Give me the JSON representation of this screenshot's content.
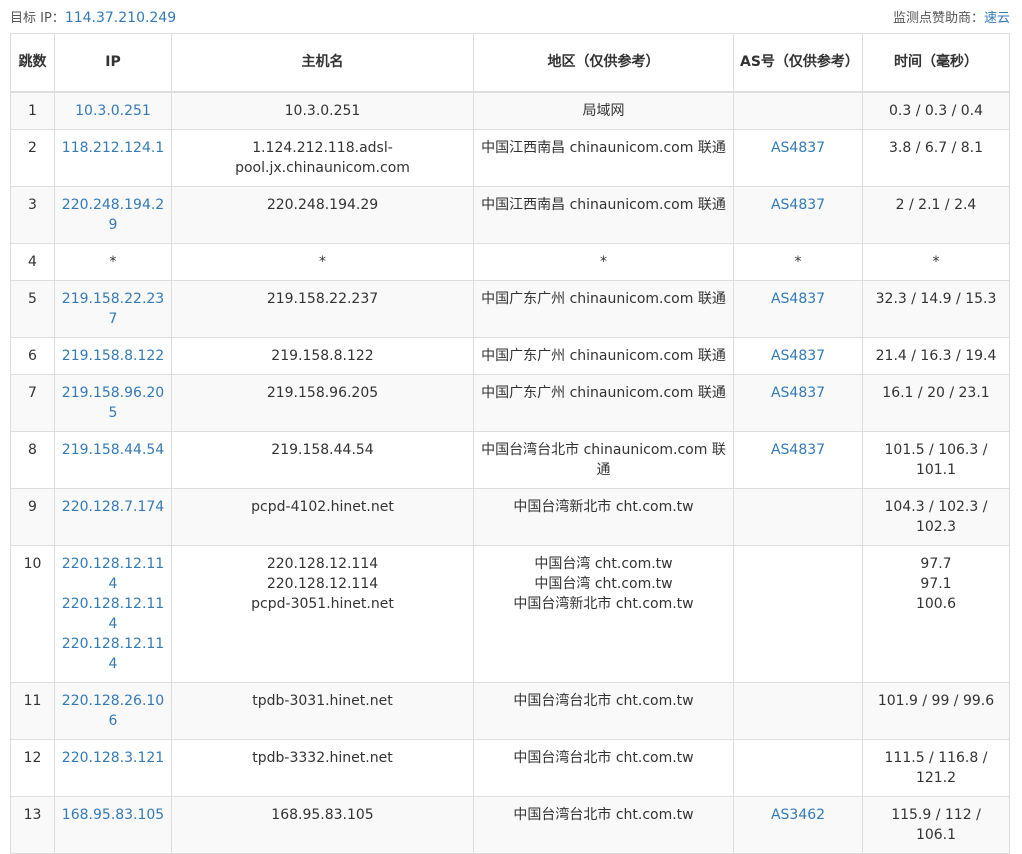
{
  "header": {
    "target_label": "目标 IP：",
    "target_ip": "114.37.210.249",
    "sponsor_label": "监测点赞助商：",
    "sponsor_name": "速云"
  },
  "columns": [
    "跳数",
    "IP",
    "主机名",
    "地区（仅供参考）",
    "AS号（仅供参考）",
    "时间（毫秒）"
  ],
  "rows": [
    {
      "hop": "1",
      "ips": [
        "10.3.0.251"
      ],
      "hosts": [
        "10.3.0.251"
      ],
      "regions": [
        "局域网"
      ],
      "asn": "",
      "times": [
        "0.3 / 0.3 / 0.4"
      ]
    },
    {
      "hop": "2",
      "ips": [
        "118.212.124.1"
      ],
      "hosts": [
        "1.124.212.118.adsl-pool.jx.chinaunicom.com"
      ],
      "regions": [
        "中国江西南昌 chinaunicom.com 联通"
      ],
      "asn": "AS4837",
      "times": [
        "3.8 / 6.7 / 8.1"
      ]
    },
    {
      "hop": "3",
      "ips": [
        "220.248.194.29"
      ],
      "hosts": [
        "220.248.194.29"
      ],
      "regions": [
        "中国江西南昌 chinaunicom.com 联通"
      ],
      "asn": "AS4837",
      "times": [
        "2 / 2.1 / 2.4"
      ]
    },
    {
      "hop": "4",
      "ips": [
        "*"
      ],
      "hosts": [
        "*"
      ],
      "regions": [
        "*"
      ],
      "asn": "*",
      "times": [
        "*"
      ],
      "ip_plain": true
    },
    {
      "hop": "5",
      "ips": [
        "219.158.22.237"
      ],
      "hosts": [
        "219.158.22.237"
      ],
      "regions": [
        "中国广东广州 chinaunicom.com 联通"
      ],
      "asn": "AS4837",
      "times": [
        "32.3 / 14.9 / 15.3"
      ]
    },
    {
      "hop": "6",
      "ips": [
        "219.158.8.122"
      ],
      "hosts": [
        "219.158.8.122"
      ],
      "regions": [
        "中国广东广州 chinaunicom.com 联通"
      ],
      "asn": "AS4837",
      "times": [
        "21.4 / 16.3 / 19.4"
      ]
    },
    {
      "hop": "7",
      "ips": [
        "219.158.96.205"
      ],
      "hosts": [
        "219.158.96.205"
      ],
      "regions": [
        "中国广东广州 chinaunicom.com 联通"
      ],
      "asn": "AS4837",
      "times": [
        "16.1 / 20 / 23.1"
      ]
    },
    {
      "hop": "8",
      "ips": [
        "219.158.44.54"
      ],
      "hosts": [
        "219.158.44.54"
      ],
      "regions": [
        "中国台湾台北市 chinaunicom.com 联通"
      ],
      "asn": "AS4837",
      "times": [
        "101.5 / 106.3 / 101.1"
      ]
    },
    {
      "hop": "9",
      "ips": [
        "220.128.7.174"
      ],
      "hosts": [
        "pcpd-4102.hinet.net"
      ],
      "regions": [
        "中国台湾新北市 cht.com.tw"
      ],
      "asn": "",
      "times": [
        "104.3 / 102.3 / 102.3"
      ]
    },
    {
      "hop": "10",
      "ips": [
        "220.128.12.114",
        "220.128.12.114",
        "220.128.12.114"
      ],
      "hosts": [
        "220.128.12.114",
        "220.128.12.114",
        "pcpd-3051.hinet.net"
      ],
      "regions": [
        "中国台湾 cht.com.tw",
        "中国台湾 cht.com.tw",
        "中国台湾新北市 cht.com.tw"
      ],
      "asn": "",
      "times": [
        "97.7",
        "97.1",
        "100.6"
      ]
    },
    {
      "hop": "11",
      "ips": [
        "220.128.26.106"
      ],
      "hosts": [
        "tpdb-3031.hinet.net"
      ],
      "regions": [
        "中国台湾台北市 cht.com.tw"
      ],
      "asn": "",
      "times": [
        "101.9 / 99 / 99.6"
      ]
    },
    {
      "hop": "12",
      "ips": [
        "220.128.3.121"
      ],
      "hosts": [
        "tpdb-3332.hinet.net"
      ],
      "regions": [
        "中国台湾台北市 cht.com.tw"
      ],
      "asn": "",
      "times": [
        "111.5 / 116.8 / 121.2"
      ]
    },
    {
      "hop": "13",
      "ips": [
        "168.95.83.105"
      ],
      "hosts": [
        "168.95.83.105"
      ],
      "regions": [
        "中国台湾台北市 cht.com.tw"
      ],
      "asn": "AS3462",
      "times": [
        "115.9 / 112 / 106.1"
      ]
    }
  ]
}
